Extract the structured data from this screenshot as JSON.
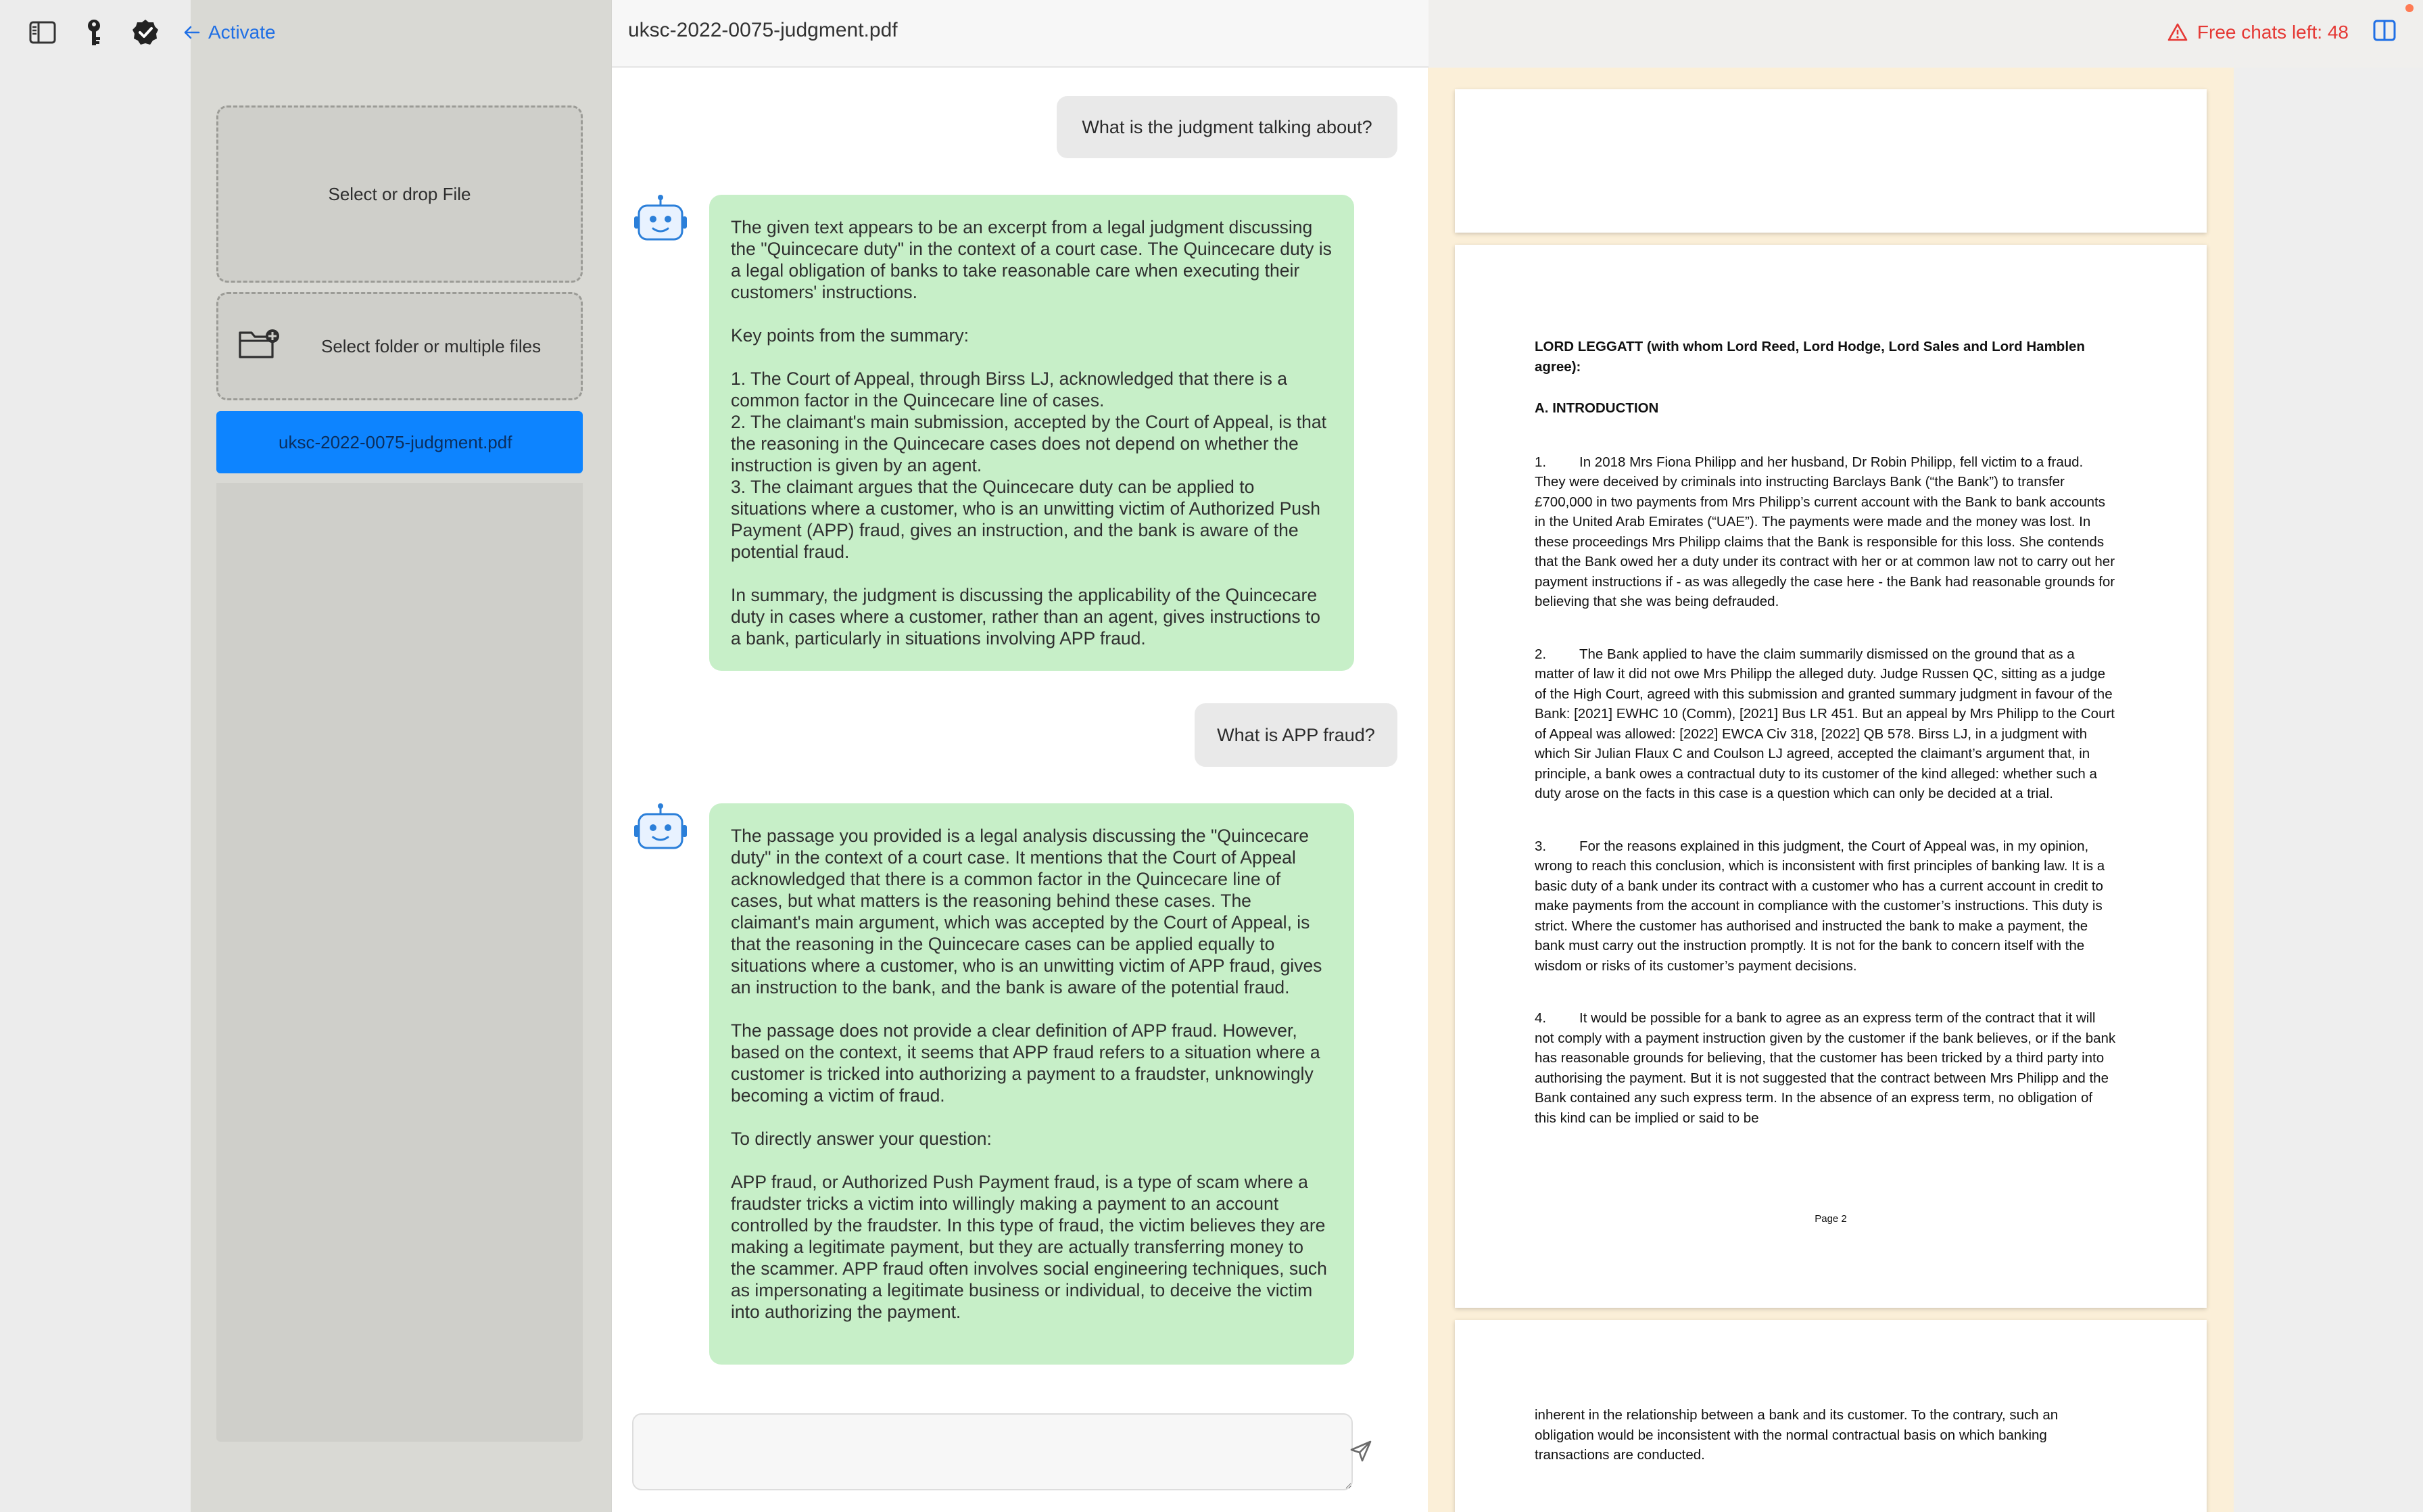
{
  "toolbar": {
    "activate_label": "Activate",
    "icons": [
      "sidebar-toggle-icon",
      "key-icon",
      "verified-badge-icon",
      "arrow-left-icon"
    ]
  },
  "files": {
    "drop_file_label": "Select or drop File",
    "drop_folder_label": "Select folder or multiple files",
    "items": [
      {
        "name": "uksc-2022-0075-judgment.pdf",
        "selected": true
      }
    ]
  },
  "chat": {
    "document_title": "uksc-2022-0075-judgment.pdf",
    "messages": [
      {
        "role": "user",
        "text": "What is the judgment talking about?"
      },
      {
        "role": "bot",
        "text": "The given text appears to be an excerpt from a legal judgment discussing the \"Quincecare duty\" in the context of a court case. The Quincecare duty is a legal obligation of banks to take reasonable care when executing their customers' instructions.\n\nKey points from the summary:\n\n1. The Court of Appeal, through Birss LJ, acknowledged that there is a common factor in the Quincecare line of cases.\n2. The claimant's main submission, accepted by the Court of Appeal, is that the reasoning in the Quincecare cases does not depend on whether the instruction is given by an agent.\n3. The claimant argues that the Quincecare duty can be applied to situations where a customer, who is an unwitting victim of Authorized Push Payment (APP) fraud, gives an instruction, and the bank is aware of the potential fraud.\n\nIn summary, the judgment is discussing the applicability of the Quincecare duty in cases where a customer, rather than an agent, gives instructions to a bank, particularly in situations involving APP fraud."
      },
      {
        "role": "user",
        "text": "What is APP fraud?"
      },
      {
        "role": "bot",
        "text": "The passage you provided is a legal analysis discussing the \"Quincecare duty\" in the context of a court case. It mentions that the Court of Appeal acknowledged that there is a common factor in the Quincecare line of cases, but what matters is the reasoning behind these cases. The claimant's main argument, which was accepted by the Court of Appeal, is that the reasoning in the Quincecare cases can be applied equally to situations where a customer, who is an unwitting victim of APP fraud, gives an instruction to the bank, and the bank is aware of the potential fraud.\n\nThe passage does not provide a clear definition of APP fraud. However, based on the context, it seems that APP fraud refers to a situation where a customer is tricked into authorizing a payment to a fraudster, unknowingly becoming a victim of fraud.\n\nTo directly answer your question:\n\nAPP fraud, or Authorized Push Payment fraud, is a type of scam where a fraudster tricks a victim into willingly making a payment to an account controlled by the fraudster. In this type of fraud, the victim believes they are making a legitimate payment, but they are actually transferring money to the scammer. APP fraud often involves social engineering techniques, such as impersonating a legitimate business or individual, to deceive the victim into authorizing the payment."
      }
    ],
    "input_placeholder": ""
  },
  "status": {
    "free_chats_label": "Free chats left: 48"
  },
  "pdf": {
    "page2": {
      "heading": "LORD LEGGATT (with whom Lord Reed, Lord Hodge, Lord Sales and Lord Hamblen agree):",
      "section": "A.  INTRODUCTION",
      "paragraphs": [
        {
          "num": "1.",
          "text": "In 2018 Mrs Fiona Philipp and her husband, Dr Robin Philipp, fell victim to a fraud. They were deceived by criminals into instructing Barclays Bank (“the Bank”) to transfer £700,000 in two payments from Mrs Philipp’s current account with the Bank to bank accounts in the United Arab Emirates (“UAE”). The payments were made and the money was lost. In these proceedings Mrs Philipp claims that the Bank is responsible for this loss. She contends that the Bank owed her a duty under its contract with her or at common law not to carry out her payment instructions if - as was allegedly the case here - the Bank had reasonable grounds for believing that she was being defrauded."
        },
        {
          "num": "2.",
          "text": "The Bank applied to have the claim summarily dismissed on the ground that as a matter of law it did not owe Mrs Philipp the alleged duty. Judge Russen QC, sitting as a judge of the High Court, agreed with this submission and granted summary judgment in favour of the Bank: [2021] EWHC 10 (Comm), [2021] Bus LR 451. But an appeal by Mrs Philipp to the Court of Appeal was allowed: [2022] EWCA Civ 318, [2022] QB 578. Birss LJ, in a judgment with which Sir Julian Flaux C and Coulson LJ agreed, accepted the claimant’s argument that, in principle, a bank owes a contractual duty to its customer of the kind alleged: whether such a duty arose on the facts in this case is a question which can only be decided at a trial."
        },
        {
          "num": "3.",
          "text": "For the reasons explained in this judgment, the Court of Appeal was, in my opinion, wrong to reach this conclusion, which is inconsistent with first principles of banking law. It is a basic duty of a bank under its contract with a customer who has a current account in credit to make payments from the account in compliance with the customer’s instructions. This duty is strict. Where the customer has authorised and instructed the bank to make a payment, the bank must carry out the instruction promptly. It is not for the bank to concern itself with the wisdom or risks of its customer’s payment decisions."
        },
        {
          "num": "4.",
          "text": "It would be possible for a bank to agree as an express term of the contract that it will not comply with a payment instruction given by the customer if the bank believes, or if the bank has reasonable grounds for believing, that the customer has been tricked by a third party into authorising the payment. But it is not suggested that the contract between Mrs Philipp and the Bank contained any such express term. In the absence of an express term, no obligation of this kind can be implied or said to be"
        }
      ],
      "page_label": "Page 2"
    },
    "page3": {
      "text": "inherent in the relationship between a bank and its customer. To the contrary, such an obligation would be inconsistent with the normal contractual basis on which banking transactions are conducted."
    }
  },
  "colors": {
    "accent": "#0d84ff",
    "bot_bubble": "#c7efc8",
    "user_bubble": "#e9e9e9",
    "warning": "#e53935",
    "pdf_bg": "#fbefd8"
  }
}
